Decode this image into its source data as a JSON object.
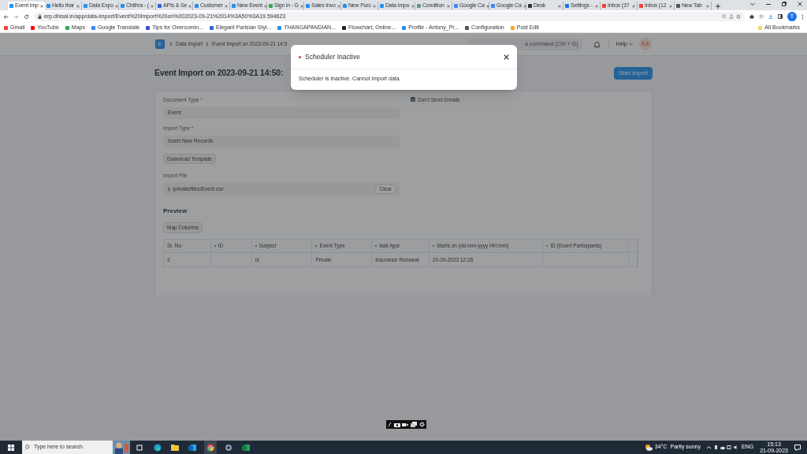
{
  "browser": {
    "tabs": [
      {
        "label": "Event Imp",
        "selected": true,
        "color": "#2490ef"
      },
      {
        "label": "Hello thar",
        "selected": false,
        "color": "#2490ef"
      },
      {
        "label": "Data Expo",
        "selected": false,
        "color": "#2490ef"
      },
      {
        "label": "Chithra - (",
        "selected": false,
        "color": "#2490ef"
      },
      {
        "label": "APIs & Se",
        "selected": false,
        "color": "#3b5bdb"
      },
      {
        "label": "Customer",
        "selected": false,
        "color": "#2490ef"
      },
      {
        "label": "New Event",
        "selected": false,
        "color": "#2490ef"
      },
      {
        "label": "Sign in - G",
        "selected": false,
        "color": "#34a853"
      },
      {
        "label": "Sales Invo",
        "selected": false,
        "color": "#2490ef"
      },
      {
        "label": "New Purc",
        "selected": false,
        "color": "#2490ef"
      },
      {
        "label": "Data Impo",
        "selected": false,
        "color": "#2490ef"
      },
      {
        "label": "Condition",
        "selected": false,
        "color": "#5f9e8f"
      },
      {
        "label": "Google Ca",
        "selected": false,
        "color": "#4285f4"
      },
      {
        "label": "Google Ca",
        "selected": false,
        "color": "#4285f4"
      },
      {
        "label": "Desk",
        "selected": false,
        "color": "#333333"
      },
      {
        "label": "Settings -",
        "selected": false,
        "color": "#1a73e8"
      },
      {
        "label": "Inbox (37",
        "selected": false,
        "color": "#ea4335"
      },
      {
        "label": "Inbox (12",
        "selected": false,
        "color": "#ea4335"
      },
      {
        "label": "New Tab",
        "selected": false,
        "color": "#555555"
      }
    ],
    "address": "erp.dhisai.in/app/data-import/Event%20Import%20on%202023-09-21%2014%3A50%3A19.594623",
    "profile": "T",
    "bookmarks": [
      {
        "label": "Gmail",
        "color": "#ea4335"
      },
      {
        "label": "YouTube",
        "color": "#ff0000"
      },
      {
        "label": "Maps",
        "color": "#34a853"
      },
      {
        "label": "Google Translate",
        "color": "#4285f4"
      },
      {
        "label": "Tips for Overcomin...",
        "color": "#3c4fd0"
      },
      {
        "label": "Elegant Parisian Styl...",
        "color": "#3367d6"
      },
      {
        "label": "THANGAPANDIAN...",
        "color": "#2490ef"
      },
      {
        "label": "Flowchart, Online...",
        "color": "#222222"
      },
      {
        "label": "Profile - Antony_Pr...",
        "color": "#2490ef"
      },
      {
        "label": "Configuration",
        "color": "#555555"
      },
      {
        "label": "Post Edit",
        "color": "#f5a623"
      }
    ],
    "all_bookmarks": "All Bookmarks"
  },
  "app": {
    "logo": "E",
    "breadcrumbs": [
      "Data Import",
      "Event Import on 2023-09-21 14:5"
    ],
    "search": {
      "placeholder": "a command (Ctrl + G)"
    },
    "help": "Help",
    "avatar": "EA",
    "title": "Event Import on 2023-09-21 14:50:",
    "primary_button": "Start Import",
    "fields": [
      {
        "label": "Document Type",
        "required": "*",
        "value": "Event"
      },
      {
        "label": "Import Type",
        "required": "*",
        "value": "Insert New Records"
      }
    ],
    "dont_send_emails": {
      "label": "Don't Send Emails",
      "checked": true
    },
    "download_template": "Download Template",
    "import_file": {
      "label": "Import File",
      "value": "/private/files/Event.csv",
      "clear": "Clear"
    },
    "preview": {
      "title": "Preview",
      "map_columns": "Map Columns",
      "columns": [
        {
          "label": "Sr. No",
          "dot": false
        },
        {
          "label": "ID",
          "dot": true
        },
        {
          "label": "Subject",
          "dot": true
        },
        {
          "label": "Event Type",
          "dot": true
        },
        {
          "label": "task type",
          "dot": true
        },
        {
          "label": "Starts on (dd-mm-yyyy HH:mm)",
          "dot": true
        },
        {
          "label": "ID (Event Participants)",
          "dot": true
        }
      ],
      "rows": [
        [
          "2",
          null,
          "hi",
          "Private",
          "Insurance Renewal",
          "20-09-2023 12:26",
          null
        ]
      ]
    }
  },
  "modal": {
    "title": "Scheduler Inactive",
    "message": "Scheduler is inactive. Cannot import data."
  },
  "taskbar": {
    "search_placeholder": "Type here to search",
    "temperature": "34°C",
    "condition": "Partly sunny",
    "language": "ENG",
    "time": "15:13",
    "date": "21-09-2023"
  }
}
